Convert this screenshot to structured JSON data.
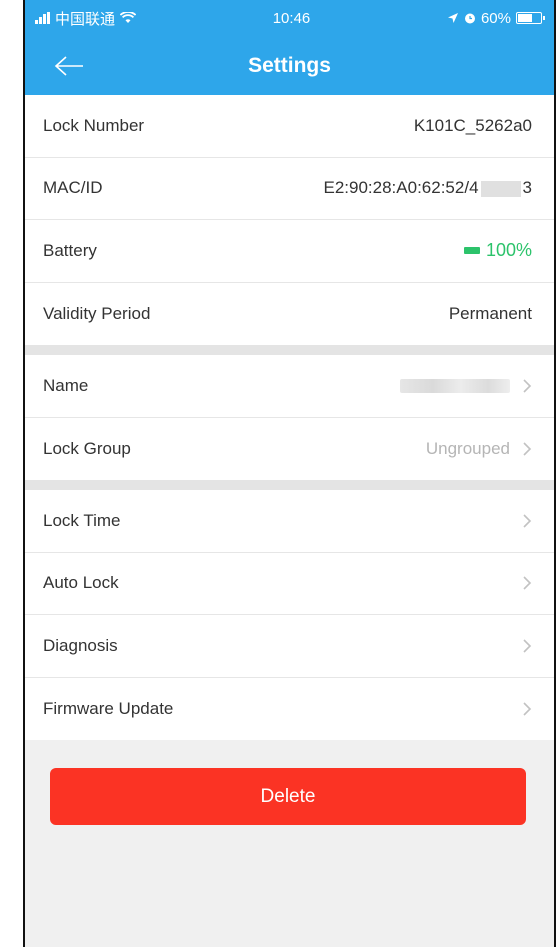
{
  "status_bar": {
    "carrier": "中国联通",
    "time": "10:46",
    "battery_percent": "60%"
  },
  "nav": {
    "title": "Settings"
  },
  "info_section": [
    {
      "label": "Lock Number",
      "value": "K101C_5262a0"
    },
    {
      "label": "MAC/ID",
      "value_prefix": "E2:90:28:A0:62:52/4",
      "value_suffix": "3"
    },
    {
      "label": "Battery",
      "value": "100%"
    },
    {
      "label": "Validity Period",
      "value": "Permanent"
    }
  ],
  "edit_section": [
    {
      "label": "Name",
      "value": ""
    },
    {
      "label": "Lock Group",
      "value": "Ungrouped"
    }
  ],
  "settings_section": [
    {
      "label": "Lock Time"
    },
    {
      "label": "Auto Lock"
    },
    {
      "label": "Diagnosis"
    },
    {
      "label": "Firmware Update"
    }
  ],
  "delete_button": {
    "label": "Delete"
  },
  "colors": {
    "header_blue": "#2ea6ea",
    "battery_green": "#2cc36b",
    "delete_red": "#fb3324"
  }
}
